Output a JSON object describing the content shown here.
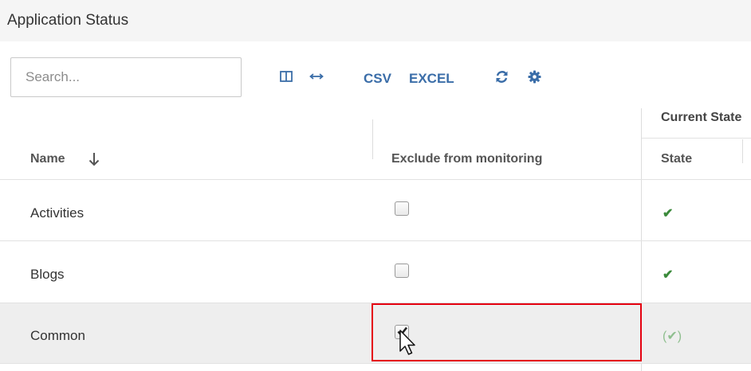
{
  "header": {
    "title": "Application Status"
  },
  "toolbar": {
    "search_placeholder": "Search...",
    "columns_icon": "columns-icon",
    "resize_icon": "resize-horizontal-icon",
    "csv_label": "CSV",
    "excel_label": "EXCEL",
    "refresh_icon": "refresh-icon",
    "settings_icon": "gear-icon"
  },
  "table": {
    "group_header": "Current State",
    "columns": {
      "name": "Name",
      "exclude": "Exclude from monitoring",
      "state": "State"
    },
    "sort": {
      "column": "Name",
      "direction": "descending"
    },
    "rows": [
      {
        "name": "Activities",
        "excluded": false,
        "state": "✔",
        "selected": false
      },
      {
        "name": "Blogs",
        "excluded": false,
        "state": "✔",
        "selected": false
      },
      {
        "name": "Common",
        "excluded": true,
        "state": "(✔)",
        "selected": true
      }
    ]
  },
  "colors": {
    "accent": "#3a6da8",
    "ok_green": "#3b8a3b",
    "muted_green": "#8fbf8f",
    "highlight": "#e4000f",
    "selected_row": "#eeeeee"
  }
}
